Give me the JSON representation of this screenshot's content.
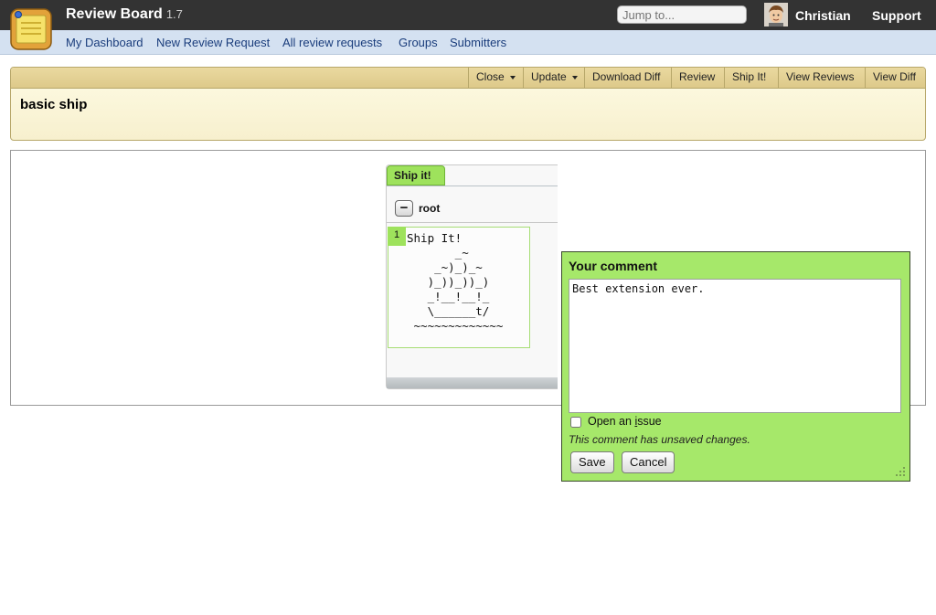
{
  "header": {
    "brand": "Review Board",
    "version": "1.7",
    "jump_placeholder": "Jump to...",
    "username": "Christian",
    "support": "Support"
  },
  "nav": {
    "items": [
      "My Dashboard",
      "New Review Request",
      "All review requests",
      "Groups",
      "Submitters"
    ]
  },
  "review_request": {
    "actions": {
      "close": "Close",
      "update": "Update",
      "download_diff": "Download Diff",
      "review": "Review",
      "ship_it": "Ship It!",
      "view_reviews": "View Reviews",
      "view_diff": "View Diff"
    },
    "summary": "basic ship"
  },
  "file_panel": {
    "tab_label": "Ship it!",
    "collapse_symbol": "−",
    "node_label": "root",
    "line_number": "1",
    "content": "Ship It!\n       _~\n    _~)_)_~\n   )_))_))_)\n   _!__!__!_\n   \\______t/\n ~~~~~~~~~~~~~"
  },
  "comment_dialog": {
    "title": "Your comment",
    "text": "Best extension ever.",
    "open_issue_prefix": "Open an ",
    "open_issue_accel": "i",
    "open_issue_suffix": "ssue",
    "open_issue_checked": false,
    "unsaved_note": "This comment has unsaved changes.",
    "save_label": "Save",
    "cancel_label": "Cancel"
  },
  "colors": {
    "topbar": "#333333",
    "navbar": "#d4e1f1",
    "review_box": "#fefbe4",
    "ship_green": "#9ee25c",
    "dialog_green": "#a6e86a"
  }
}
